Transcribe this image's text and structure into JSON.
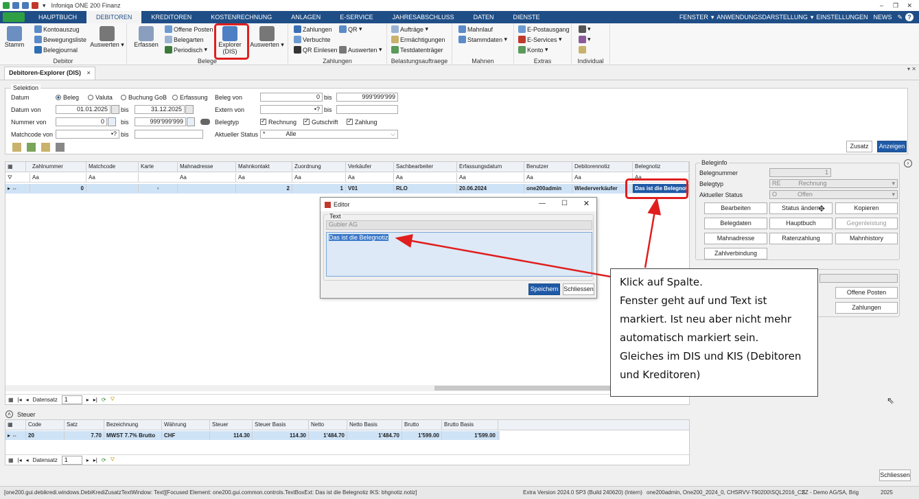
{
  "window": {
    "title": "Infoniqa ONE 200 Finanz"
  },
  "menu": {
    "items": [
      "HAUPTBUCH",
      "DEBITOREN",
      "KREDITOREN",
      "KOSTENRECHNUNG",
      "ANLAGEN",
      "E-SERVICE",
      "JAHRESABSCHLUSS",
      "DATEN",
      "DIENSTE"
    ],
    "right": [
      "FENSTER",
      "ANWENDUNGSDARSTELLUNG",
      "EINSTELLUNGEN",
      "NEWS"
    ]
  },
  "ribbon": {
    "stamm": "Stamm",
    "kontoauszug": "Kontoauszug",
    "bewegungsliste": "Bewegungsliste",
    "belegjournal": "Belegjournal",
    "auswerten1": "Auswerten",
    "group_debitor": "Debitor",
    "erfassen": "Erfassen",
    "offene_posten": "Offene Posten",
    "belegarten": "Belegarten",
    "periodisch": "Periodisch",
    "explorer_line1": "Explorer",
    "explorer_line2": "(DIS)",
    "auswerten2": "Auswerten",
    "group_belege": "Belege",
    "zahlungen": "Zahlungen",
    "verbuchte": "Verbuchte",
    "qr_einlesen": "QR Einlesen",
    "qr": "QR",
    "auswerten3": "Auswerten",
    "group_zahlungen": "Zahlungen",
    "auftraege": "Aufträge",
    "ermaechtigungen": "Ermächtigungen",
    "testdatentraeger": "Testdatenträger",
    "group_belastung": "Belastungsauftraege",
    "mahnlauf": "Mahnlauf",
    "stammdaten": "Stammdaten",
    "group_mahnen": "Mahnen",
    "epostausgang": "E-Postausgang",
    "eservices": "E-Services",
    "konto": "Konto",
    "group_extras": "Extras",
    "group_individual": "Individual"
  },
  "tab": {
    "label": "Debitoren-Explorer (DIS)",
    "close": "×"
  },
  "selektion": {
    "legend": "Selektion",
    "datum_label": "Datum",
    "radio_beleg": "Beleg",
    "radio_valuta": "Valuta",
    "radio_buchung": "Buchung GoB",
    "radio_erfassung": "Erfassung",
    "datum_von_label": "Datum von",
    "datum_von": "01.01.2025",
    "datum_bis": "31.12.2025",
    "bis": "bis",
    "nummer_von_label": "Nummer von",
    "nummer_von": "0",
    "nummer_bis": "999'999'999",
    "matchcode_label": "Matchcode von",
    "matchcode_von": "•?",
    "beleg_von_label": "Beleg von",
    "beleg_von": "0",
    "beleg_bis": "999'999'999",
    "extern_von_label": "Extern von",
    "extern_von": "•?",
    "belegtyp_label": "Belegtyp",
    "chk_rechnung": "Rechnung",
    "chk_gutschrift": "Gutschrift",
    "chk_zahlung": "Zahlung",
    "status_label": "Aktueller Status",
    "status_code": "*",
    "status_value": "Alle",
    "zusatz": "Zusatz",
    "anzeigen": "Anzeigen"
  },
  "grid": {
    "columns": [
      "Zahlnummer",
      "Matchcode",
      "Karte",
      "Mahnadresse",
      "Mahnkontakt",
      "Zuordnung",
      "Verkäufer",
      "Sachbearbeiter",
      "Erfassungsdatum",
      "Benutzer",
      "Debitorennotiz",
      "Belegnotiz"
    ],
    "row": {
      "zahlnummer": "0",
      "mahnkontakt": "2",
      "zuordnung": "1",
      "verkaeufer_nr": "0",
      "verkaeufer": "V01",
      "sachbearbeiter": "RLO",
      "erfassungsdatum": "20.06.2024",
      "benutzer": "one200admin",
      "debitorennotiz": "Wiederverkäufer",
      "belegnotiz": "Das ist die Belegnotiz"
    },
    "filter_glyph": "Aa",
    "nav_label": "Datensatz",
    "nav_value": "1"
  },
  "beleginfo": {
    "legend": "Beleginfo",
    "belegnummer_label": "Belegnummer",
    "belegnummer": "1",
    "belegtyp_label": "Belegtyp",
    "belegtyp_code": "RE",
    "belegtyp": "Rechnung",
    "status_label": "Aktueller Status",
    "status_code": "O",
    "status": "Offen",
    "buttons": [
      "Bearbeiten",
      "Status ändern",
      "Kopieren",
      "Belegdaten",
      "Hauptbuch",
      "Gegenleistung",
      "Mahnadresse",
      "Ratenzahlung",
      "Mahnhistory",
      "Zahlverbindung"
    ],
    "offene_posten": "Offene Posten",
    "zahlungen": "Zahlungen"
  },
  "steuer": {
    "title": "Steuer",
    "columns": [
      "Code",
      "Satz",
      "Bezeichnung",
      "Währung",
      "Steuer",
      "Steuer Basis",
      "Netto",
      "Netto Basis",
      "Brutto",
      "Brutto Basis"
    ],
    "row": [
      "20",
      "7.70",
      "MWST 7.7% Brutto",
      "CHF",
      "114.30",
      "114.30",
      "1'484.70",
      "1'484.70",
      "1'599.00",
      "1'599.00"
    ],
    "nav_label": "Datensatz",
    "nav_value": "1"
  },
  "editor": {
    "title": "Editor",
    "text_label": "Text",
    "company": "Gubler AG",
    "content": "Das ist die Belegnotiz",
    "save": "Speichern",
    "close": "Schliessen"
  },
  "callout": {
    "text": "Klick auf Spalte.\nFenster geht auf und Text ist markiert. Ist neu aber nicht mehr automatisch markiert sein.\nGleiches im DIS und KIS (Debitoren und Kreditoren)"
  },
  "footer": {
    "schliessen": "Schliessen"
  },
  "status": {
    "left": "[one200.gui.debikredi.windows.DebiKrediZusatzTextWindow: Text][Focused Element: one200.gui.common.controls.TextBoxExt: Das ist die Belegnotiz IKS: bhgnotiz.notiz]",
    "version": "Extra Version 2024.0 SP3 (Build 240620) (Intern)",
    "db": "one200admin, One200_2024_0, CHSRVV-T90200\\SQL2016_CS",
    "company": "ZZ - Demo AG/SA, Brig",
    "year": "2025"
  },
  "colors": {
    "accent": "#1f4e86",
    "highlight": "#e01e1e",
    "selection": "#cfe3f7"
  }
}
